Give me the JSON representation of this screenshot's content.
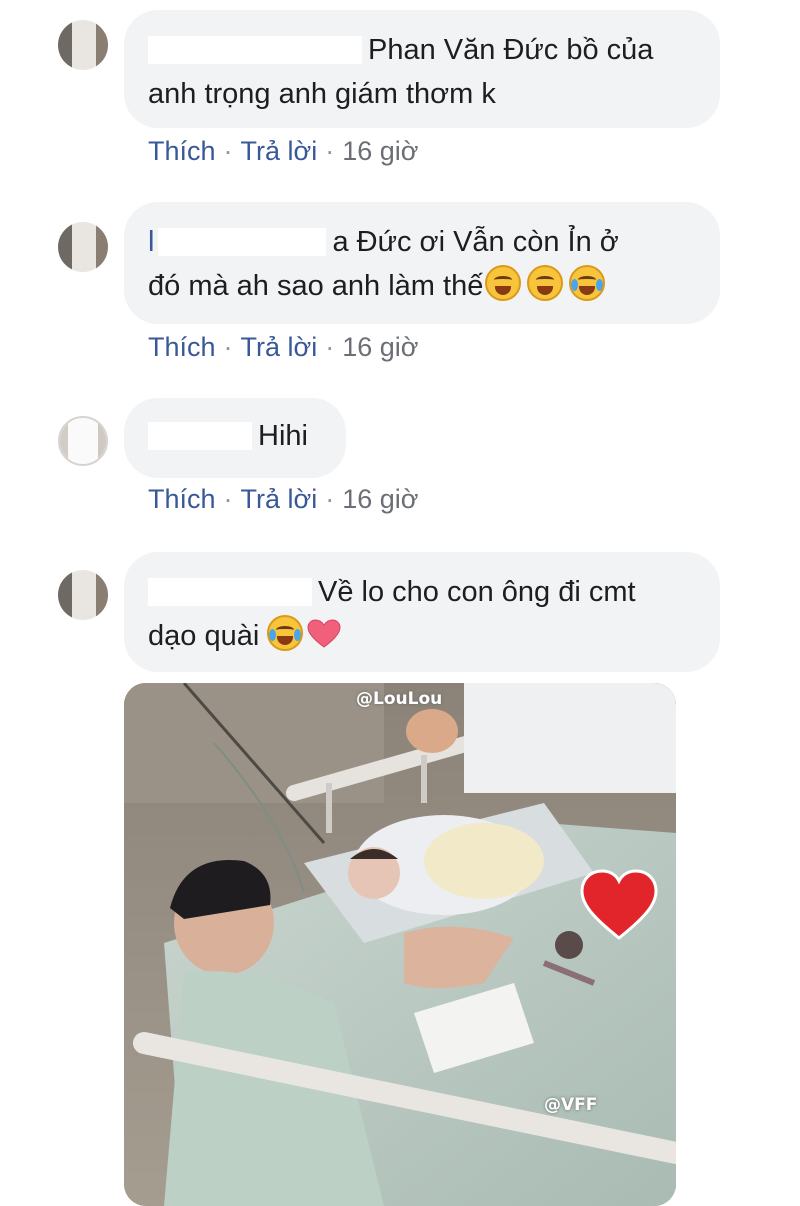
{
  "comments": [
    {
      "text_line1": "Phan Văn Đức bồ của",
      "text_line2": "anh trọng anh giám thơm k",
      "actions": {
        "like": "Thích",
        "reply": "Trả lời",
        "time": "16 giờ"
      }
    },
    {
      "name_visible": "l",
      "text_line1": "a Đức ơi Vẫn còn Ỉn ở",
      "text_line2": "đó mà ah sao anh làm thế",
      "emojis": [
        "grinning-face",
        "grinning-face",
        "tears-of-joy-face"
      ],
      "actions": {
        "like": "Thích",
        "reply": "Trả lời",
        "time": "16 giờ"
      }
    },
    {
      "text_line1": "Hihi",
      "actions": {
        "like": "Thích",
        "reply": "Trả lời",
        "time": "16 giờ"
      }
    },
    {
      "text_line1": "Về lo cho con ông đi cmt",
      "text_line2": "dạo quài",
      "emojis": [
        "tears-of-joy-face",
        "heart"
      ],
      "photo": {
        "watermark_top": "@LouLou",
        "watermark_bottom": "@VFF",
        "description_icon": "hospital-photo-image"
      }
    }
  ],
  "colors": {
    "bubble": "#f2f3f5",
    "link": "#385898",
    "text": "#1c1e21",
    "meta": "#6b6f75"
  }
}
